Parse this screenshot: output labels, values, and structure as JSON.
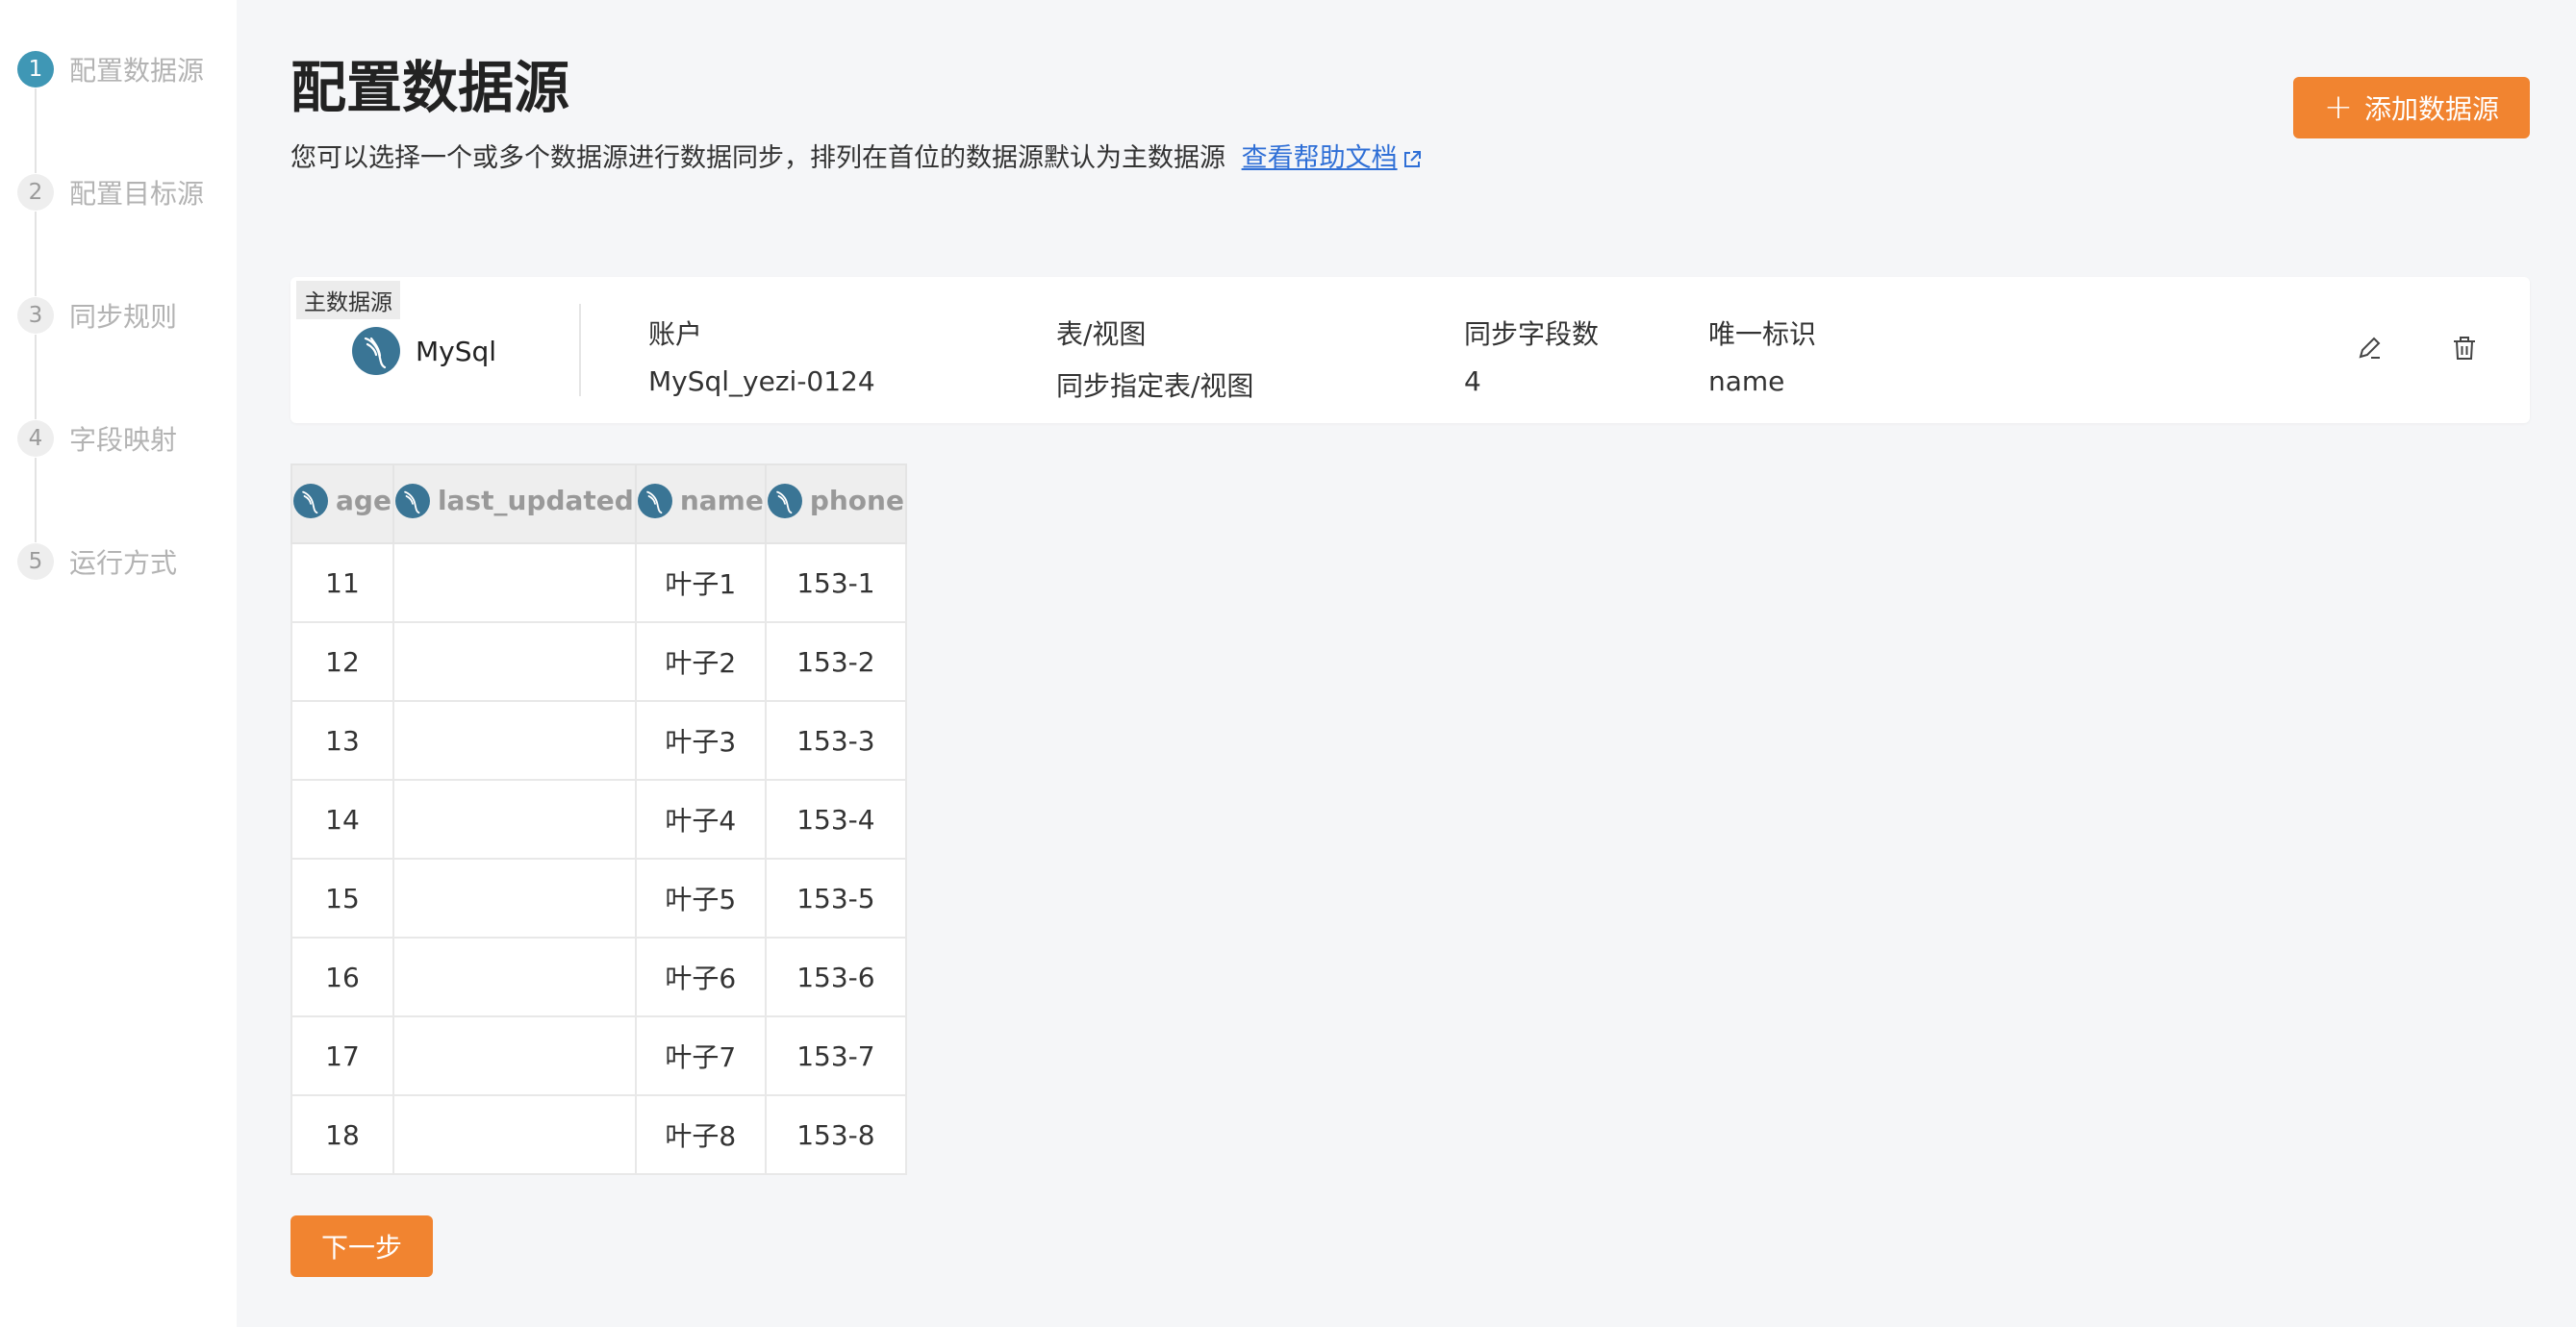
{
  "steps": [
    {
      "num": "1",
      "label": "配置数据源",
      "active": true
    },
    {
      "num": "2",
      "label": "配置目标源",
      "active": false
    },
    {
      "num": "3",
      "label": "同步规则",
      "active": false
    },
    {
      "num": "4",
      "label": "字段映射",
      "active": false
    },
    {
      "num": "5",
      "label": "运行方式",
      "active": false
    }
  ],
  "header": {
    "title": "配置数据源",
    "description": "您可以选择一个或多个数据源进行数据同步，排列在首位的数据源默认为主数据源",
    "help_link": "查看帮助文档",
    "add_button": "添加数据源"
  },
  "source": {
    "tag": "主数据源",
    "name": "MySql",
    "account_label": "账户",
    "account_value": "MySql_yezi-0124",
    "table_label": "表/视图",
    "table_value": "同步指定表/视图",
    "fields_label": "同步字段数",
    "fields_value": "4",
    "key_label": "唯一标识",
    "key_value": "name",
    "edit_icon": "edit-icon",
    "delete_icon": "trash-icon"
  },
  "table": {
    "columns": [
      "age",
      "last_updated",
      "name",
      "phone"
    ],
    "rows": [
      [
        "11",
        "",
        "叶子1",
        "153-1"
      ],
      [
        "12",
        "",
        "叶子2",
        "153-2"
      ],
      [
        "13",
        "",
        "叶子3",
        "153-3"
      ],
      [
        "14",
        "",
        "叶子4",
        "153-4"
      ],
      [
        "15",
        "",
        "叶子5",
        "153-5"
      ],
      [
        "16",
        "",
        "叶子6",
        "153-6"
      ],
      [
        "17",
        "",
        "叶子7",
        "153-7"
      ],
      [
        "18",
        "",
        "叶子8",
        "153-8"
      ]
    ]
  },
  "footer": {
    "next_button": "下一步"
  },
  "colors": {
    "accent": "#f18430",
    "step_active": "#3f97b5",
    "link": "#2f6fd6",
    "mysql_logo": "#3a7595"
  }
}
